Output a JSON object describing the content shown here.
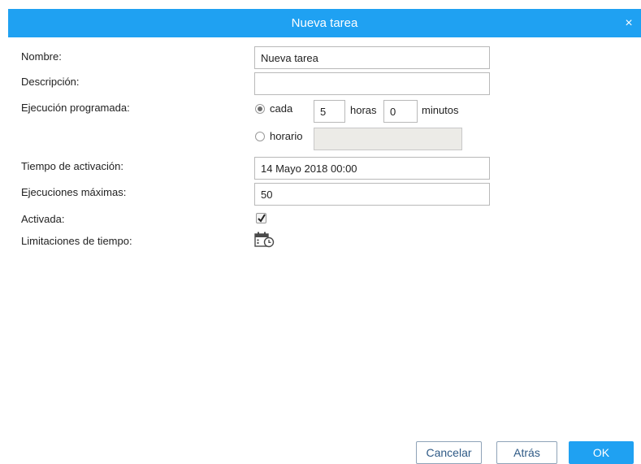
{
  "dialog": {
    "title": "Nueva tarea",
    "close_symbol": "×"
  },
  "form": {
    "name_label": "Nombre:",
    "name_value": "Nueva tarea",
    "description_label": "Descripción:",
    "description_value": "",
    "schedule_label": "Ejecución programada:",
    "schedule_mode": "cada",
    "cada_label": "cada",
    "hours_value": "5",
    "hours_unit": "horas",
    "minutes_value": "0",
    "minutes_unit": "minutos",
    "horario_label": "horario",
    "horario_value": "",
    "activation_label": "Tiempo de activación:",
    "activation_value": "14 Mayo 2018 00:00",
    "max_exec_label": "Ejecuciones máximas:",
    "max_exec_value": "50",
    "enabled_label": "Activada:",
    "enabled": true,
    "time_limits_label": "Limitaciones de tiempo:"
  },
  "buttons": {
    "cancel": "Cancelar",
    "back": "Atrás",
    "ok": "OK"
  },
  "colors": {
    "accent": "#1fa1f2",
    "disabled_field": "#ecebe7"
  },
  "icons": {
    "close": "close-icon",
    "calendar": "calendar-clock-icon",
    "check": "checkmark-icon"
  }
}
